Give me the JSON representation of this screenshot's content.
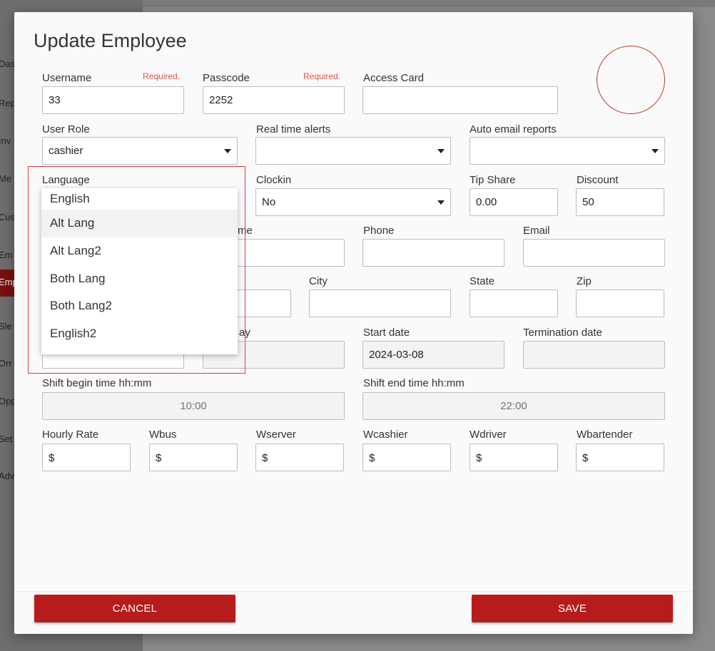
{
  "background": {
    "sidebar_items": [
      {
        "label": "Das",
        "active": false
      },
      {
        "label": "Rep",
        "active": false
      },
      {
        "label": "Inv",
        "active": false
      },
      {
        "label": "Me",
        "active": false
      },
      {
        "label": "Cus",
        "active": false
      },
      {
        "label": "Em",
        "active": false
      },
      {
        "label": "Emp",
        "active": true
      },
      {
        "label": "Sle",
        "active": false
      },
      {
        "label": "Orr",
        "active": false
      },
      {
        "label": "Opp",
        "active": false
      },
      {
        "label": "Set",
        "active": false
      },
      {
        "label": "Adv",
        "active": false
      }
    ]
  },
  "modal": {
    "title": "Update Employee",
    "required_text": "Required.",
    "fields": {
      "username": {
        "label": "Username",
        "value": "33"
      },
      "passcode": {
        "label": "Passcode",
        "value": "2252"
      },
      "access_card": {
        "label": "Access Card",
        "value": ""
      },
      "user_role": {
        "label": "User Role",
        "value": "cashier"
      },
      "realtime_alerts": {
        "label": "Real time alerts",
        "value": ""
      },
      "auto_email": {
        "label": "Auto email reports",
        "value": ""
      },
      "language": {
        "label": "Language",
        "value": "Alt Lang"
      },
      "clockin": {
        "label": "Clockin",
        "value": "No"
      },
      "tip_share": {
        "label": "Tip Share",
        "value": "0.00"
      },
      "discount": {
        "label": "Discount",
        "value": "50"
      },
      "last_name": {
        "label": "me",
        "value": ""
      },
      "phone": {
        "label": "Phone",
        "value": ""
      },
      "email": {
        "label": "Email",
        "value": ""
      },
      "address": {
        "value": ""
      },
      "city": {
        "label": "City",
        "value": ""
      },
      "state": {
        "label": "State",
        "value": ""
      },
      "zip": {
        "label": "Zip",
        "value": ""
      },
      "birthday": {
        "label": "ay",
        "value": ""
      },
      "start_date": {
        "label": "Start date",
        "value": "2024-03-08"
      },
      "termination_date": {
        "label": "Termination date",
        "value": ""
      },
      "shift_begin": {
        "label": "Shift begin time hh:mm",
        "placeholder": "10:00"
      },
      "shift_end": {
        "label": "Shift end time hh:mm",
        "placeholder": "22:00"
      },
      "hourly_rate": {
        "label": "Hourly Rate",
        "value": ""
      },
      "wbus": {
        "label": "Wbus",
        "value": ""
      },
      "wserver": {
        "label": "Wserver",
        "value": ""
      },
      "wcashier": {
        "label": "Wcashier",
        "value": ""
      },
      "wdriver": {
        "label": "Wdriver",
        "value": ""
      },
      "wbartender": {
        "label": "Wbartender",
        "value": ""
      }
    },
    "currency_symbol": "$",
    "language_options": [
      "English",
      "Alt Lang",
      "Alt Lang2",
      "Both Lang",
      "Both Lang2",
      "English2"
    ],
    "language_hovered": "Alt Lang",
    "cancel_label": "CANCEL",
    "save_label": "SAVE"
  },
  "colors": {
    "accent": "#b71c1c",
    "required": "#d9534f",
    "highlight_border": "#e53935"
  }
}
